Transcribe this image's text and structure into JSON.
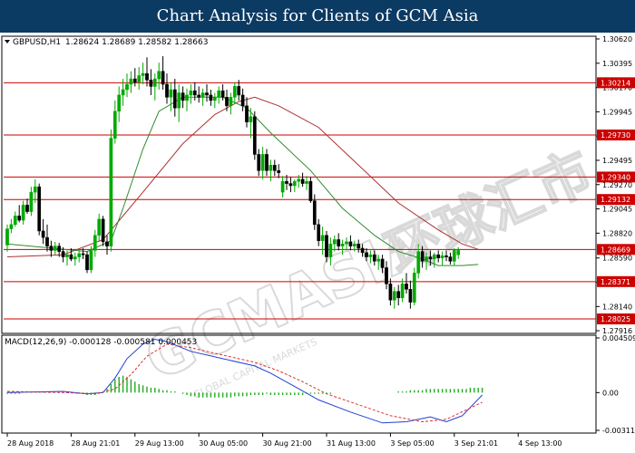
{
  "header": {
    "title": "Chart Analysis for Clients of GCM Asia"
  },
  "colors": {
    "background": "#ffffff",
    "header_bg": "#0b3a63",
    "up_candle": "#00aa00",
    "down_candle": "#000000",
    "level_line": "#cc0000",
    "ma_fast": "#2e8b2e",
    "ma_slow": "#b03030",
    "macd_line": "#1f3fd6",
    "macd_signal": "#e03030",
    "macd_hist": "#22aa22"
  },
  "watermark": {
    "main": "GCMASIA",
    "cn": "环球汇市",
    "sub": "GLOBAL CAPITAL MARKETS"
  },
  "chart_data": [
    {
      "type": "candlestick",
      "symbol_label": "GBPUSD,H1",
      "ohlc_label": "1.28624 1.28689 1.28582 1.28663",
      "ylim": [
        1.27916,
        1.3062
      ],
      "ytick_labels": [
        "1.30620",
        "1.30395",
        "1.30170",
        "1.29945",
        "1.29720",
        "1.29495",
        "1.29270",
        "1.29045",
        "1.28820",
        "1.28590",
        "1.28365",
        "1.28140",
        "1.27916"
      ],
      "ytick_values": [
        1.3062,
        1.30395,
        1.3017,
        1.29945,
        1.2972,
        1.29495,
        1.2927,
        1.29045,
        1.2882,
        1.2859,
        1.28365,
        1.2814,
        1.27916
      ],
      "levels": [
        "1.30214",
        "1.29730",
        "1.29340",
        "1.29132",
        "1.28669",
        "1.28371",
        "1.28025"
      ],
      "level_values": [
        1.30214,
        1.2973,
        1.2934,
        1.29132,
        1.28669,
        1.28371,
        1.28025
      ],
      "x_labels": [
        "28 Aug 2018",
        "28 Aug 21:01",
        "29 Aug 13:00",
        "30 Aug 05:00",
        "30 Aug 21:00",
        "31 Aug 13:00",
        "3 Sep 05:00",
        "3 Sep 21:01",
        "4 Sep 13:00"
      ],
      "x_label_index": [
        0,
        16,
        32,
        48,
        64,
        80,
        96,
        112,
        128
      ],
      "candles": [
        [
          1.2871,
          1.289,
          1.2865,
          1.2886
        ],
        [
          1.2886,
          1.2895,
          1.2882,
          1.289
        ],
        [
          1.289,
          1.2902,
          1.2888,
          1.2898
        ],
        [
          1.2898,
          1.2908,
          1.2892,
          1.2894
        ],
        [
          1.2894,
          1.2912,
          1.289,
          1.2908
        ],
        [
          1.2908,
          1.2914,
          1.29,
          1.2902
        ],
        [
          1.2902,
          1.2925,
          1.2898,
          1.292
        ],
        [
          1.292,
          1.2932,
          1.291,
          1.2925
        ],
        [
          1.2925,
          1.2928,
          1.288,
          1.2884
        ],
        [
          1.2884,
          1.2895,
          1.2872,
          1.2878
        ],
        [
          1.2878,
          1.289,
          1.2865,
          1.287
        ],
        [
          1.287,
          1.2875,
          1.286,
          1.2866
        ],
        [
          1.2866,
          1.2874,
          1.2862,
          1.287
        ],
        [
          1.287,
          1.2873,
          1.286,
          1.2865
        ],
        [
          1.2865,
          1.2869,
          1.2855,
          1.286
        ],
        [
          1.286,
          1.2866,
          1.2852,
          1.2862
        ],
        [
          1.2862,
          1.2868,
          1.2856,
          1.2858
        ],
        [
          1.2858,
          1.2864,
          1.2852,
          1.286
        ],
        [
          1.286,
          1.2866,
          1.2855,
          1.2863
        ],
        [
          1.2863,
          1.2868,
          1.2858,
          1.2862
        ],
        [
          1.2862,
          1.2865,
          1.2845,
          1.2848
        ],
        [
          1.2848,
          1.287,
          1.2845,
          1.2866
        ],
        [
          1.2866,
          1.2885,
          1.286,
          1.288
        ],
        [
          1.288,
          1.29,
          1.2874,
          1.2895
        ],
        [
          1.2895,
          1.2898,
          1.287,
          1.2874
        ],
        [
          1.2874,
          1.288,
          1.2862,
          1.287
        ],
        [
          1.287,
          1.2978,
          1.2865,
          1.297
        ],
        [
          1.297,
          1.3005,
          1.2965,
          1.2995
        ],
        [
          1.2995,
          1.3018,
          1.2985,
          1.301
        ],
        [
          1.301,
          1.3025,
          1.3,
          1.3015
        ],
        [
          1.3015,
          1.303,
          1.3008,
          1.302
        ],
        [
          1.302,
          1.3032,
          1.3012,
          1.3025
        ],
        [
          1.3025,
          1.3035,
          1.3018,
          1.3022
        ],
        [
          1.3022,
          1.3036,
          1.3015,
          1.3028
        ],
        [
          1.3028,
          1.304,
          1.302,
          1.303
        ],
        [
          1.303,
          1.3045,
          1.3018,
          1.3024
        ],
        [
          1.3024,
          1.3034,
          1.301,
          1.3018
        ],
        [
          1.3018,
          1.303,
          1.3005,
          1.3025
        ],
        [
          1.3025,
          1.304,
          1.3015,
          1.3032
        ],
        [
          1.3032,
          1.3046,
          1.3015,
          1.302
        ],
        [
          1.302,
          1.303,
          1.3002,
          1.3008
        ],
        [
          1.3008,
          1.3022,
          1.2995,
          1.3015
        ],
        [
          1.3015,
          1.3025,
          1.299,
          1.2998
        ],
        [
          1.2998,
          1.302,
          1.2985,
          1.3012
        ],
        [
          1.3012,
          1.3018,
          1.2998,
          1.3005
        ],
        [
          1.3005,
          1.3016,
          1.2995,
          1.301
        ],
        [
          1.301,
          1.302,
          1.3002,
          1.3014
        ],
        [
          1.3014,
          1.3022,
          1.3005,
          1.301
        ],
        [
          1.301,
          1.3018,
          1.3003,
          1.3008
        ],
        [
          1.3008,
          1.3016,
          1.3,
          1.3012
        ],
        [
          1.3012,
          1.302,
          1.3004,
          1.301
        ],
        [
          1.301,
          1.3015,
          1.3,
          1.3005
        ],
        [
          1.3005,
          1.3012,
          1.2998,
          1.3008
        ],
        [
          1.3008,
          1.3018,
          1.3002,
          1.3014
        ],
        [
          1.3014,
          1.302,
          1.3005,
          1.3008
        ],
        [
          1.3008,
          1.3015,
          1.2995,
          1.3
        ],
        [
          1.3,
          1.3012,
          1.2992,
          1.3008
        ],
        [
          1.3008,
          1.3022,
          1.3002,
          1.3018
        ],
        [
          1.3018,
          1.3024,
          1.3005,
          1.301
        ],
        [
          1.301,
          1.3016,
          1.2995,
          1.3
        ],
        [
          1.3,
          1.3008,
          1.298,
          1.2985
        ],
        [
          1.2985,
          1.2998,
          1.297,
          1.299
        ],
        [
          1.299,
          1.2995,
          1.295,
          1.2955
        ],
        [
          1.2955,
          1.296,
          1.2935,
          1.294
        ],
        [
          1.294,
          1.2962,
          1.2932,
          1.2955
        ],
        [
          1.2955,
          1.296,
          1.2935,
          1.294
        ],
        [
          1.294,
          1.295,
          1.293,
          1.2945
        ],
        [
          1.2945,
          1.295,
          1.2935,
          1.294
        ],
        [
          1.294,
          1.2946,
          1.2933,
          1.2938
        ],
        [
          1.292,
          1.2935,
          1.2915,
          1.293
        ],
        [
          1.293,
          1.2936,
          1.2922,
          1.2928
        ],
        [
          1.2928,
          1.2934,
          1.292,
          1.2926
        ],
        [
          1.2926,
          1.2932,
          1.292,
          1.293
        ],
        [
          1.293,
          1.2936,
          1.2924,
          1.2932
        ],
        [
          1.2932,
          1.2938,
          1.2925,
          1.2928
        ],
        [
          1.2928,
          1.2935,
          1.2922,
          1.293
        ],
        [
          1.293,
          1.2934,
          1.291,
          1.2912
        ],
        [
          1.2912,
          1.2918,
          1.2885,
          1.289
        ],
        [
          1.289,
          1.2895,
          1.287,
          1.2875
        ],
        [
          1.2875,
          1.2888,
          1.2862,
          1.288
        ],
        [
          1.288,
          1.2884,
          1.2855,
          1.286
        ],
        [
          1.286,
          1.2878,
          1.2852,
          1.2872
        ],
        [
          1.2872,
          1.288,
          1.2865,
          1.2876
        ],
        [
          1.2876,
          1.2882,
          1.2866,
          1.287
        ],
        [
          1.287,
          1.2876,
          1.2862,
          1.2872
        ],
        [
          1.2872,
          1.2878,
          1.2866,
          1.2874
        ],
        [
          1.2874,
          1.288,
          1.2866,
          1.287
        ],
        [
          1.287,
          1.2875,
          1.2865,
          1.2872
        ],
        [
          1.2872,
          1.2876,
          1.2864,
          1.2868
        ],
        [
          1.2868,
          1.2872,
          1.286,
          1.2864
        ],
        [
          1.2864,
          1.2868,
          1.2856,
          1.286
        ],
        [
          1.286,
          1.2866,
          1.2854,
          1.2862
        ],
        [
          1.2862,
          1.2866,
          1.2852,
          1.2856
        ],
        [
          1.2856,
          1.2862,
          1.2848,
          1.2858
        ],
        [
          1.2858,
          1.2862,
          1.2845,
          1.285
        ],
        [
          1.285,
          1.2856,
          1.283,
          1.2835
        ],
        [
          1.2835,
          1.284,
          1.2815,
          1.282
        ],
        [
          1.282,
          1.2832,
          1.2812,
          1.2828
        ],
        [
          1.2828,
          1.2834,
          1.2815,
          1.2822
        ],
        [
          1.2822,
          1.284,
          1.2818,
          1.2835
        ],
        [
          1.2835,
          1.2845,
          1.2826,
          1.283
        ],
        [
          1.283,
          1.2838,
          1.2812,
          1.2818
        ],
        [
          1.2818,
          1.285,
          1.2815,
          1.2845
        ],
        [
          1.2845,
          1.2872,
          1.284,
          1.2865
        ],
        [
          1.2865,
          1.287,
          1.285,
          1.2856
        ],
        [
          1.2856,
          1.2864,
          1.2848,
          1.286
        ],
        [
          1.286,
          1.2866,
          1.2852,
          1.2858
        ],
        [
          1.2858,
          1.2864,
          1.285,
          1.2862
        ],
        [
          1.2862,
          1.2866,
          1.2855,
          1.2859
        ],
        [
          1.2859,
          1.2865,
          1.2852,
          1.2861
        ],
        [
          1.2861,
          1.2866,
          1.2856,
          1.286
        ],
        [
          1.286,
          1.2864,
          1.2853,
          1.2856
        ],
        [
          1.2856,
          1.2868,
          1.2852,
          1.2866
        ],
        [
          1.2862,
          1.2869,
          1.2858,
          1.2866
        ]
      ],
      "ma_fast": [
        [
          0,
          1.2872
        ],
        [
          20,
          1.2865
        ],
        [
          26,
          1.2875
        ],
        [
          29,
          1.2905
        ],
        [
          34,
          1.296
        ],
        [
          38,
          1.2995
        ],
        [
          44,
          1.3008
        ],
        [
          54,
          1.3008
        ],
        [
          60,
          1.2998
        ],
        [
          66,
          1.2975
        ],
        [
          76,
          1.294
        ],
        [
          84,
          1.2905
        ],
        [
          92,
          1.288
        ],
        [
          98,
          1.2865
        ],
        [
          104,
          1.2858
        ],
        [
          108,
          1.2852
        ],
        [
          114,
          1.2852
        ],
        [
          118,
          1.2853
        ]
      ],
      "ma_slow": [
        [
          0,
          1.286
        ],
        [
          14,
          1.2862
        ],
        [
          24,
          1.2876
        ],
        [
          34,
          1.292
        ],
        [
          44,
          1.2965
        ],
        [
          52,
          1.2992
        ],
        [
          58,
          1.3004
        ],
        [
          62,
          1.3008
        ],
        [
          68,
          1.3
        ],
        [
          78,
          1.298
        ],
        [
          88,
          1.2945
        ],
        [
          98,
          1.291
        ],
        [
          108,
          1.2885
        ],
        [
          114,
          1.2872
        ],
        [
          118,
          1.2867
        ]
      ]
    },
    {
      "type": "line",
      "name": "MACD(12,26,9) -0.000128 -0.000581 0.000453",
      "ylim": [
        -0.003113,
        0.004509
      ],
      "ytick_labels": [
        "0.004509",
        "0.00",
        "-0.003113"
      ],
      "ytick_values": [
        0.004509,
        0.0,
        -0.003113
      ],
      "macd": [
        [
          0,
          0.0
        ],
        [
          14,
          0.0001
        ],
        [
          20,
          -0.0001
        ],
        [
          24,
          0.0
        ],
        [
          27,
          0.0012
        ],
        [
          30,
          0.0028
        ],
        [
          34,
          0.004
        ],
        [
          37,
          0.0044
        ],
        [
          40,
          0.0042
        ],
        [
          46,
          0.0034
        ],
        [
          54,
          0.0028
        ],
        [
          62,
          0.0022
        ],
        [
          66,
          0.0016
        ],
        [
          72,
          0.0005
        ],
        [
          78,
          -0.0006
        ],
        [
          86,
          -0.0016
        ],
        [
          94,
          -0.0025
        ],
        [
          100,
          -0.0024
        ],
        [
          106,
          -0.002
        ],
        [
          110,
          -0.0024
        ],
        [
          114,
          -0.0019
        ],
        [
          119,
          -0.0002
        ]
      ],
      "signal": [
        [
          0,
          0.0001
        ],
        [
          14,
          0.0
        ],
        [
          22,
          -0.0001
        ],
        [
          27,
          0.0003
        ],
        [
          31,
          0.0015
        ],
        [
          35,
          0.003
        ],
        [
          40,
          0.004
        ],
        [
          46,
          0.0037
        ],
        [
          54,
          0.0031
        ],
        [
          62,
          0.0025
        ],
        [
          68,
          0.0018
        ],
        [
          74,
          0.0009
        ],
        [
          80,
          -0.0001
        ],
        [
          88,
          -0.001
        ],
        [
          96,
          -0.0019
        ],
        [
          104,
          -0.0024
        ],
        [
          110,
          -0.0022
        ],
        [
          119,
          -0.0008
        ]
      ],
      "histogram": [
        -0.0001,
        -0.0001,
        -0.0001,
        -0.0001,
        0.0,
        0.0,
        0.0001,
        0.0001,
        0.0001,
        0.0001,
        0.0,
        0.0,
        0.0,
        0.0,
        0.0,
        0.0,
        0.0,
        0.0,
        -0.0001,
        -0.0001,
        -0.0002,
        -0.0002,
        -0.0002,
        -0.0001,
        0.0,
        0.0003,
        0.0007,
        0.0011,
        0.0013,
        0.0014,
        0.0013,
        0.0011,
        0.0009,
        0.0007,
        0.0006,
        0.0005,
        0.0004,
        0.0004,
        0.0003,
        0.0002,
        0.0002,
        0.0001,
        0.0001,
        0.0,
        -0.0001,
        -0.0002,
        -0.0003,
        -0.0003,
        -0.0004,
        -0.0004,
        -0.0004,
        -0.0004,
        -0.0004,
        -0.0004,
        -0.0004,
        -0.0004,
        -0.0004,
        -0.0003,
        -0.0003,
        -0.0003,
        -0.0003,
        -0.0002,
        -0.0002,
        -0.0002,
        -0.0002,
        -0.0001,
        -0.0002,
        -0.0002,
        -0.0002,
        -0.0002,
        -0.0002,
        -0.0002,
        -0.0002,
        -0.0002,
        -0.0002,
        -0.0001,
        -0.0001,
        -0.0001,
        -0.0001,
        -0.0001,
        -0.0001,
        -0.0001,
        0.0,
        0.0,
        0.0,
        0.0,
        0.0,
        0.0,
        0.0,
        0.0,
        0.0,
        0.0,
        0.0,
        0.0,
        0.0,
        0.0,
        0.0,
        0.0,
        0.0001,
        0.0001,
        0.0001,
        0.0002,
        0.0002,
        0.0002,
        0.0002,
        0.0003,
        0.0003,
        0.0003,
        0.0003,
        0.0003,
        0.0003,
        0.0003,
        0.0003,
        0.0003,
        0.0003,
        0.0003,
        0.0004,
        0.0004,
        0.0004,
        0.0004
      ]
    }
  ]
}
